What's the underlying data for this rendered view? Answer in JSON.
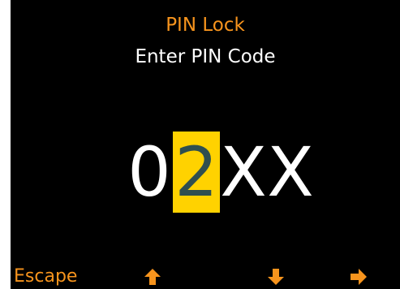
{
  "screen": {
    "title": "PIN Lock",
    "subtitle": "Enter PIN Code"
  },
  "pin": {
    "digits": [
      "0",
      "2",
      "X",
      "X"
    ],
    "active_index": 1
  },
  "softkeys": {
    "escape_label": "Escape",
    "up_icon": "arrow-up-icon",
    "down_icon": "arrow-down-icon",
    "right_icon": "arrow-right-icon"
  },
  "colors": {
    "background": "#000000",
    "accent": "#f7941d",
    "highlight": "#ffd200",
    "highlight_text": "#2f4f4f",
    "text": "#ffffff"
  }
}
